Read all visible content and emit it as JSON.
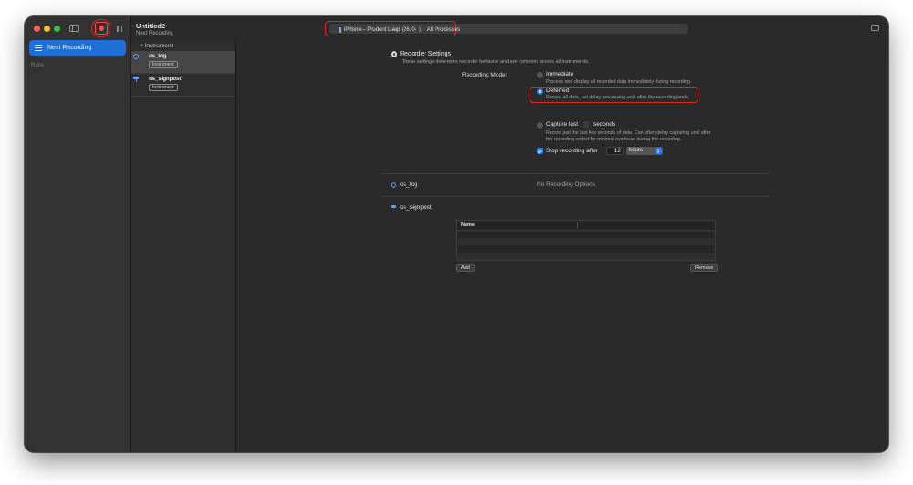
{
  "window": {
    "title": "Untitled2",
    "subtitle": "Next Recording",
    "path": {
      "device": "iPhone – Prudent Leap (26.0)",
      "separator": "〉",
      "target": "All Processes"
    }
  },
  "sidebar": {
    "items": [
      {
        "label": "Next Recording",
        "icon": "list-icon",
        "selected": true
      }
    ],
    "runs_label": "Runs"
  },
  "instruments": {
    "add_label": "+ Instrument",
    "items": [
      {
        "name": "os_log",
        "tag": "Instrument",
        "icon": "log-circle-icon",
        "selected": true
      },
      {
        "name": "os_signpost",
        "tag": "Instrument",
        "icon": "signpost-icon",
        "selected": false
      }
    ]
  },
  "recorder": {
    "title": "Recorder Settings",
    "subtitle": "These settings determine recorder behavior and are common across all instruments.",
    "mode_label": "Recording Mode:",
    "modes": [
      {
        "label": "Immediate",
        "desc": "Process and display all recorded data immediately during recording.",
        "selected": false
      },
      {
        "label": "Deferred",
        "desc": "Record all data, but delay processing until after the recording ends.",
        "selected": true
      },
      {
        "label": "Capture last",
        "suffix": "seconds",
        "desc1": "Record just the last few seconds of data. Can often delay capturing until after",
        "desc2": "the recording ended for minimal overhead during the recording.",
        "selected": false
      }
    ],
    "stop": {
      "label": "Stop recording after",
      "checked": true,
      "value": "12",
      "unit": "hours"
    }
  },
  "sections": {
    "os_log": {
      "name": "os_log",
      "note": "No Recording Options"
    },
    "os_signpost": {
      "name": "os_signpost",
      "table": {
        "columns": [
          "Name",
          ""
        ]
      },
      "add_label": "Add",
      "remove_label": "Remove"
    }
  },
  "colors": {
    "accent": "#2f7cf6",
    "highlight": "#e02424",
    "record": "#ff4a4a"
  }
}
